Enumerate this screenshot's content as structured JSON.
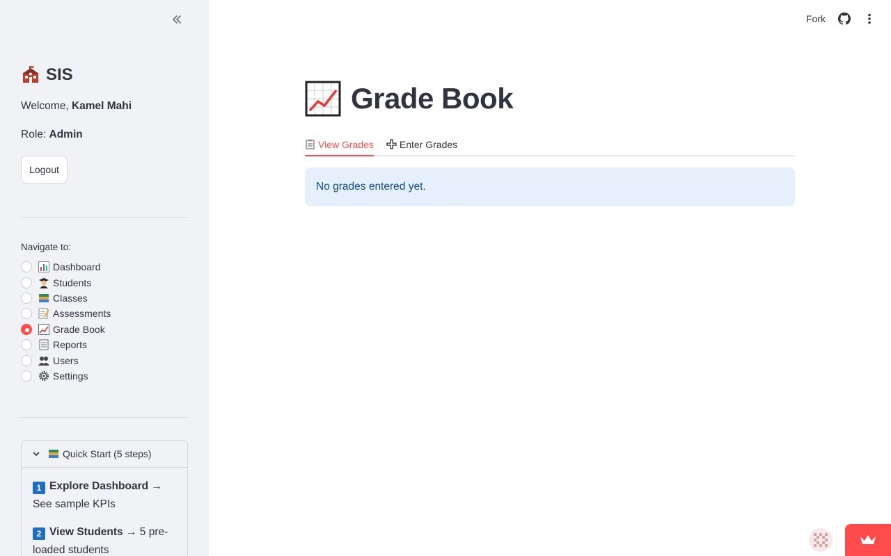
{
  "sidebar": {
    "brand_title": "SIS",
    "welcome_prefix": "Welcome, ",
    "user_name": "Kamel Mahi",
    "role_prefix": "Role: ",
    "role_value": "Admin",
    "logout_label": "Logout",
    "nav_label": "Navigate to:",
    "nav_items": [
      {
        "label": "Dashboard",
        "icon": "bar-chart-icon",
        "selected": false
      },
      {
        "label": "Students",
        "icon": "student-icon",
        "selected": false
      },
      {
        "label": "Classes",
        "icon": "books-icon",
        "selected": false
      },
      {
        "label": "Assessments",
        "icon": "memo-icon",
        "selected": false
      },
      {
        "label": "Grade Book",
        "icon": "chart-increasing-icon",
        "selected": true
      },
      {
        "label": "Reports",
        "icon": "page-icon",
        "selected": false
      },
      {
        "label": "Users",
        "icon": "users-icon",
        "selected": false
      },
      {
        "label": "Settings",
        "icon": "gear-icon",
        "selected": false
      }
    ],
    "quick_start": {
      "title": "Quick Start (5 steps)",
      "steps": [
        {
          "num": "1",
          "bold": "Explore Dashboard",
          "rest": " → See sample KPIs"
        },
        {
          "num": "2",
          "bold": "View Students",
          "rest": " → 5 pre-loaded students"
        }
      ]
    }
  },
  "header": {
    "fork_label": "Fork"
  },
  "main": {
    "title": "Grade Book",
    "tabs": [
      {
        "label": "View Grades",
        "icon": "clipboard-icon",
        "active": true
      },
      {
        "label": "Enter Grades",
        "icon": "plus-icon",
        "active": false
      }
    ],
    "info_message": "No grades entered yet."
  },
  "colors": {
    "accent": "#ff4b4b",
    "sidebar_bg": "#f0f2f6",
    "info_bg": "#e6f0fc",
    "info_text": "#0e4d8c",
    "text": "#31333f"
  }
}
